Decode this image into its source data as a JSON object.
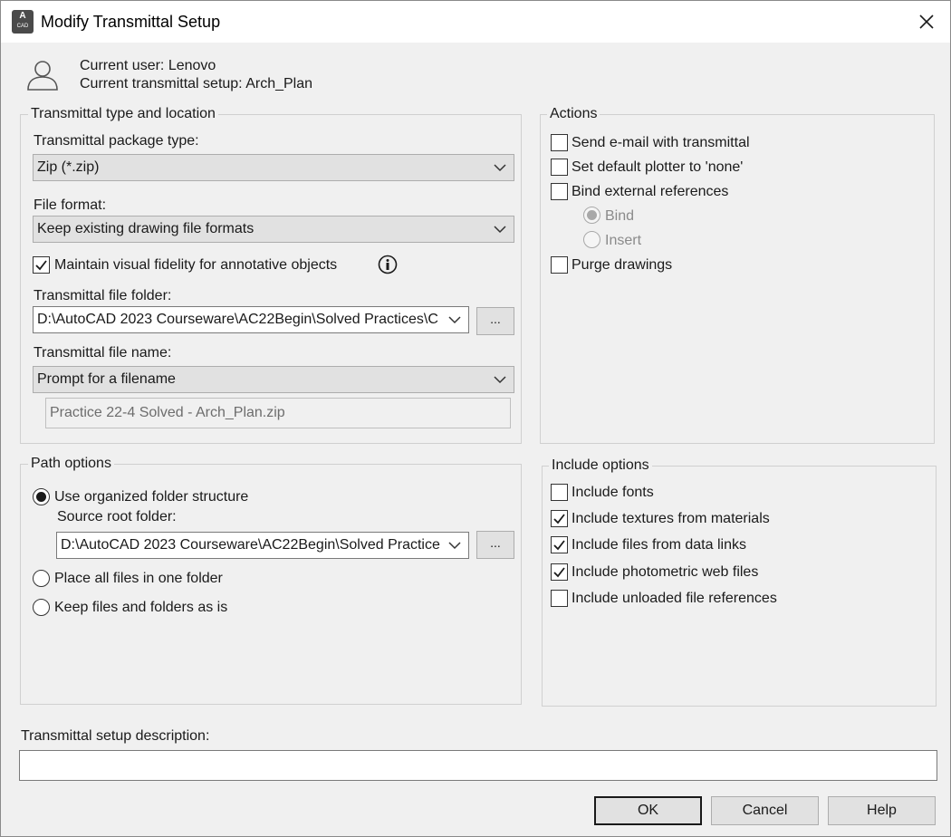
{
  "window": {
    "title": "Modify Transmittal Setup",
    "app_icon_letter": "A",
    "app_icon_sub": "CAD"
  },
  "user_info": {
    "current_user": "Current user: Lenovo",
    "current_setup": "Current transmittal setup: Arch_Plan"
  },
  "type_location": {
    "legend": "Transmittal type and location",
    "package_type_label": "Transmittal package type:",
    "package_type_value": "Zip (*.zip)",
    "file_format_label": "File format:",
    "file_format_value": "Keep existing drawing file formats",
    "fidelity_label": "Maintain visual fidelity for annotative objects",
    "fidelity_checked": true,
    "folder_label": "Transmittal file folder:",
    "folder_value": "D:\\AutoCAD 2023 Courseware\\AC22Begin\\Solved Practices\\C",
    "browse_label": "...",
    "file_name_label": "Transmittal file name:",
    "file_name_value": "Prompt for a filename",
    "file_name_preview": "Practice 22-4 Solved - Arch_Plan.zip"
  },
  "actions": {
    "legend": "Actions",
    "send_email": "Send e-mail with transmittal",
    "default_plotter": "Set default plotter to 'none'",
    "bind_xrefs": "Bind external references",
    "bind": "Bind",
    "insert": "Insert",
    "purge": "Purge drawings"
  },
  "path_options": {
    "legend": "Path options",
    "organized": "Use organized folder structure",
    "source_root_label": "Source root folder:",
    "source_root_value": "D:\\AutoCAD 2023 Courseware\\AC22Begin\\Solved Practice",
    "browse_label": "...",
    "one_folder": "Place all files in one folder",
    "keep_as_is": "Keep files and folders as is"
  },
  "include_options": {
    "legend": "Include options",
    "items": [
      {
        "label": "Include fonts",
        "checked": false
      },
      {
        "label": "Include textures from materials",
        "checked": true
      },
      {
        "label": "Include files from data links",
        "checked": true
      },
      {
        "label": "Include photometric web files",
        "checked": true
      },
      {
        "label": "Include unloaded file references",
        "checked": false
      }
    ]
  },
  "description": {
    "label": "Transmittal setup description:",
    "value": ""
  },
  "buttons": {
    "ok": "OK",
    "cancel": "Cancel",
    "help": "Help"
  }
}
